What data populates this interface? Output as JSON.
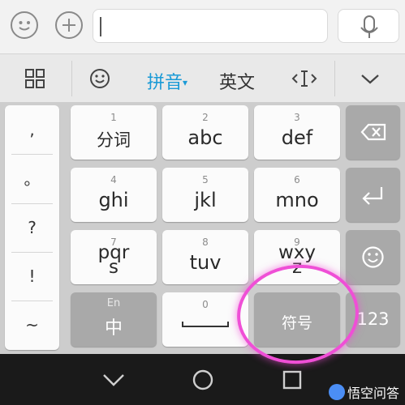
{
  "input_bar": {
    "field_value": ""
  },
  "toolbar": {
    "pinyin_label": "拼音",
    "pinyin_caret": "▾",
    "english_label": "英文"
  },
  "punctuation": [
    ",",
    "。",
    "?",
    "!",
    "~"
  ],
  "keys": [
    {
      "num": "1",
      "main": "分词"
    },
    {
      "num": "2",
      "main": "abc"
    },
    {
      "num": "3",
      "main": "def"
    },
    {
      "num": "4",
      "main": "ghi"
    },
    {
      "num": "5",
      "main": "jkl"
    },
    {
      "num": "6",
      "main": "mno"
    },
    {
      "num": "7",
      "main": "pqr",
      "sub": "s"
    },
    {
      "num": "8",
      "main": "tuv"
    },
    {
      "num": "9",
      "main": "wxy",
      "sub": "z"
    }
  ],
  "bottom_row": {
    "lang_hint": "En",
    "lang_label": "中",
    "space_num": "0",
    "symbol_label": "符号",
    "num_label": "123"
  },
  "watermark": {
    "text": "悟空问答"
  },
  "colors": {
    "accent": "#1a9ad6",
    "annotation": "#ef4fd6",
    "keyboard_bg": "#cdcdcd",
    "key_dark": "#a9a9a9"
  }
}
